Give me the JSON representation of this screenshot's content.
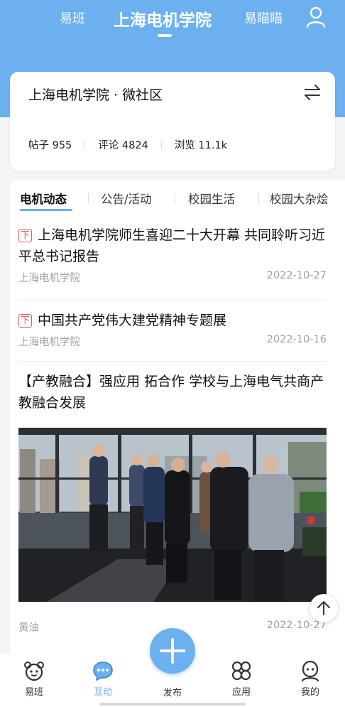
{
  "top_nav": {
    "left_label": "易班",
    "center_label": "上海电机学院",
    "right_label": "易瞄瞄"
  },
  "community": {
    "title": "上海电机学院 · 微社区",
    "stats": [
      {
        "label": "帖子",
        "value": "955"
      },
      {
        "label": "评论",
        "value": "4824"
      },
      {
        "label": "浏览",
        "value": "11.1k"
      }
    ]
  },
  "tabs": [
    "电机动态",
    "公告/活动",
    "校园生活",
    "校园大杂烩"
  ],
  "posts": [
    {
      "pin": "下",
      "title": "上海电机学院师生喜迎二十大开幕 共同聆听习近平总书记报告",
      "author": "上海电机学院",
      "date": "2022-10-27"
    },
    {
      "pin": "下",
      "title": "中国共产党伟大建党精神专题展",
      "author": "上海电机学院",
      "date": "2022-10-16"
    },
    {
      "title": "【产教融合】强应用 拓合作 学校与上海电气共商产教融合发展",
      "author": "黄油",
      "date": "2022-10-27"
    }
  ],
  "bottom_nav": [
    {
      "label": "易班",
      "icon": "bear-icon"
    },
    {
      "label": "互动",
      "icon": "chat-icon"
    },
    {
      "label": "发布",
      "icon": "plus-icon"
    },
    {
      "label": "应用",
      "icon": "apps-icon"
    },
    {
      "label": "我的",
      "icon": "person-icon"
    }
  ],
  "colors": {
    "accent": "#6cb0f0",
    "pin": "#e35d5d",
    "meta": "#a0a0a0"
  }
}
